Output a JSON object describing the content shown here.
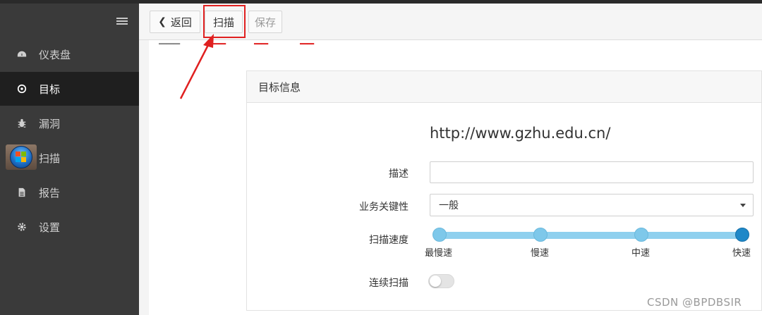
{
  "sidebar": {
    "items": [
      {
        "label": "仪表盘",
        "icon": "dashboard-icon"
      },
      {
        "label": "目标",
        "icon": "target-icon",
        "active": true
      },
      {
        "label": "漏洞",
        "icon": "bug-icon"
      },
      {
        "label": "扫描",
        "icon": "windows-orb-icon"
      },
      {
        "label": "报告",
        "icon": "report-icon"
      },
      {
        "label": "设置",
        "icon": "gear-icon"
      }
    ]
  },
  "toolbar": {
    "back_label": "返回",
    "scan_label": "扫描",
    "save_label": "保存"
  },
  "panel": {
    "title": "目标信息",
    "url": "http://www.gzhu.edu.cn/",
    "description_label": "描述",
    "description_value": "",
    "criticality_label": "业务关键性",
    "criticality_value": "一般",
    "speed_label": "扫描速度",
    "speed_options": [
      "最慢速",
      "慢速",
      "中速",
      "快速"
    ],
    "speed_selected": "快速",
    "continuous_label": "连续扫描",
    "continuous_on": false
  },
  "watermark": "CSDN @BPDBSIR",
  "colors": {
    "highlight": "#e02020",
    "slider": "#8fd0ee",
    "slider_selected": "#1f88c8",
    "sidebar_bg": "#3a3a3a",
    "sidebar_active": "#1f1f1f"
  }
}
